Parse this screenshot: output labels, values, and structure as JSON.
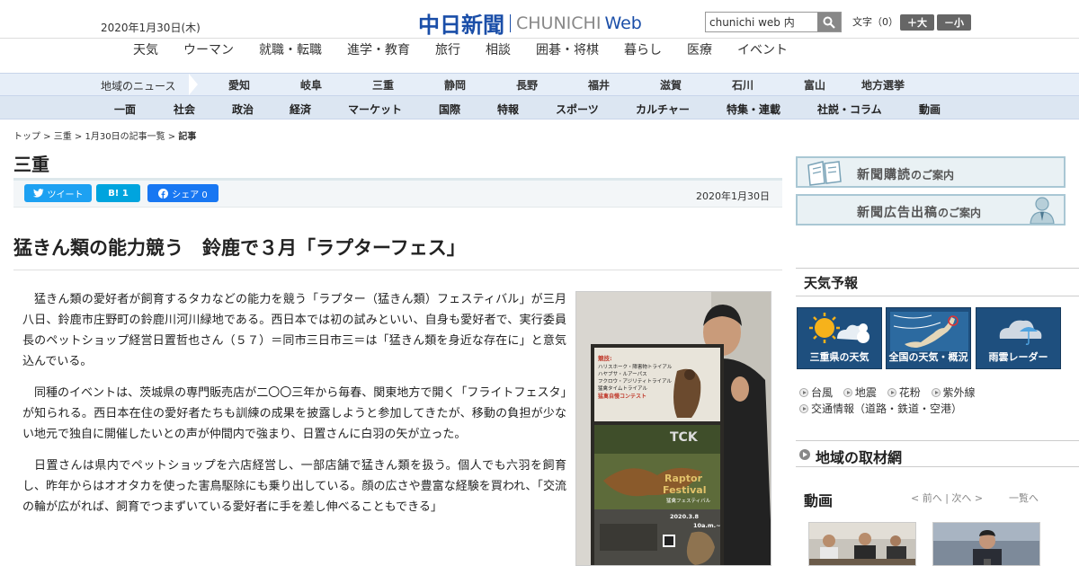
{
  "header": {
    "date": "2020年1月30日(木)",
    "logo_jp": "中日新聞",
    "logo_en": "CHUNICHI",
    "logo_web": "Web",
    "search_value": "chunichi web 内",
    "fontsize_label": "文字（0）",
    "font_big": "＋大",
    "font_small": "－小"
  },
  "topnav": [
    "天気",
    "ウーマン",
    "就職・転職",
    "進学・教育",
    "旅行",
    "相談",
    "囲碁・将棋",
    "暮らし",
    "医療",
    "イベント"
  ],
  "region": {
    "label": "地域のニュース",
    "items": [
      "愛知",
      "岐阜",
      "三重",
      "静岡",
      "長野",
      "福井",
      "滋賀",
      "石川",
      "富山",
      "地方選挙"
    ]
  },
  "categories": [
    "一面",
    "社会",
    "政治",
    "経済",
    "マーケット",
    "国際",
    "特報",
    "スポーツ",
    "カルチャー",
    "特集・連載",
    "社説・コラム",
    "動画"
  ],
  "breadcrumb": {
    "top": "トップ",
    "sep1": " > ",
    "mie": "三重",
    "sep2": " > ",
    "list": "1月30日の記事一覧",
    "sep3": " > ",
    "current": "記事"
  },
  "section_title": "三重",
  "share": {
    "tweet": "ツイート",
    "hatena": "B! 1",
    "facebook": "シェア 0",
    "date": "2020年1月30日"
  },
  "article": {
    "headline": "猛きん類の能力競う　鈴鹿で３月「ラプターフェス」",
    "paragraphs": [
      "猛きん類の愛好者が飼育するタカなどの能力を競う「ラプター（猛きん類）フェスティバル」が三月八日、鈴鹿市庄野町の鈴鹿川河川緑地である。西日本では初の試みといい、自身も愛好者で、実行委員長のペットショップ経営日置哲也さん（５７）＝同市三日市三＝は「猛きん類を身近な存在に」と意気込んでいる。",
      "同種のイベントは、茨城県の専門販売店が二〇〇三年から毎春、関東地方で開く「フライトフェスタ」が知られる。西日本在住の愛好者たちも訓練の成果を披露しようと参加してきたが、移動の負担が少ない地元で独自に開催したいとの声が仲間内で強まり、日置さんに白羽の矢が立った。",
      "日置さんは県内でペットショップを六店経営し、一部店舗で猛きん類を扱う。個人でも六羽を飼育し、昨年からはオオタカを使った害鳥駆除にも乗り出している。顔の広さや豊富な経験を買われ、「交流の輪が広がれば、飼育でつまずいている愛好者に手を差し伸べることもできる」"
    ],
    "poster": {
      "title1": "Raptor",
      "title2": "Festival",
      "subtitle": "猛禽フェスティバル",
      "date": "2020.3.8",
      "time": "10a.m.~",
      "events": [
        "ハリスホーク・障害物トライアル",
        "ハヤブサ・ルアーパス",
        "フクロウ・アジリティトライアル",
        "猛禽タイムトライアル",
        "猛禽自慢コンテスト"
      ],
      "shirt_text": "TCK"
    }
  },
  "sidebar": {
    "banner1": {
      "main": "新聞購読",
      "sub": "のご案内"
    },
    "banner2": {
      "main": "新聞広告出稿",
      "sub": "のご案内"
    },
    "weather_head": "天気予報",
    "weather_tiles": [
      "三重県の天気",
      "全国の天気・概況",
      "雨雲レーダー"
    ],
    "weather_links": [
      "台風",
      "地震",
      "花粉",
      "紫外線",
      "交通情報（道路・鉄道・空港）"
    ],
    "chaser": "地域の取材網",
    "douga_head": "動画",
    "douga_nav": "< 前へ | 次へ >",
    "douga_all": "一覧へ"
  },
  "colors": {
    "brand": "#1a4ea8",
    "region_bar": "#e6eef8",
    "category_bar": "#dce6f2",
    "tweet": "#1da1f2",
    "hatena": "#00a4de",
    "facebook": "#1877f2",
    "weather_tile": "#1e4f7e"
  }
}
